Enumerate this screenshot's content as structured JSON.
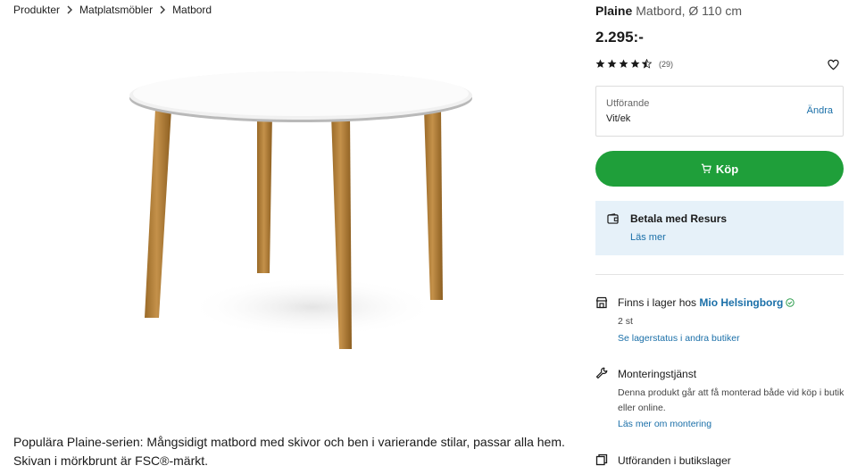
{
  "breadcrumb": {
    "items": [
      "Produkter",
      "Matplatsmöbler",
      "Matbord"
    ]
  },
  "product": {
    "brand": "Plaine",
    "subtitle": "Matbord, Ø 110 cm",
    "price": "2.295:-",
    "rating": {
      "value": 4.5,
      "max": 5,
      "count_label": "(29)"
    },
    "description": "Populära Plaine-serien: Mångsidigt matbord med skivor och ben i varierande stilar, passar alla hem. Skivan i mörkbrunt är FSC®-märkt."
  },
  "variant": {
    "label": "Utförande",
    "value": "Vit/ek",
    "change_label": "Ändra"
  },
  "buy_button": {
    "label": "Köp"
  },
  "payment": {
    "title": "Betala med Resurs",
    "link": "Läs mer"
  },
  "stock": {
    "prefix": "Finns i lager hos",
    "store": "Mio Helsingborg",
    "quantity": "2 st",
    "link": "Se lagerstatus i andra butiker"
  },
  "assembly": {
    "title": "Monteringstjänst",
    "text": "Denna produkt går att få monterad både vid köp i butik eller online.",
    "link": "Läs mer om montering"
  },
  "showroom": {
    "title": "Utföranden i butikslager"
  },
  "colors": {
    "buy_green": "#1f9f3a",
    "link_blue": "#1a6fa8",
    "payment_bg": "#e6f1f9",
    "verified_green": "#2e9e4f"
  },
  "icons": {
    "chevron": "chevron-right-icon",
    "star": "star-icon",
    "heart": "heart-icon",
    "cart": "cart-icon",
    "wallet": "wallet-icon",
    "store": "store-icon",
    "wrench": "wrench-icon",
    "showroom": "copy-icon"
  }
}
